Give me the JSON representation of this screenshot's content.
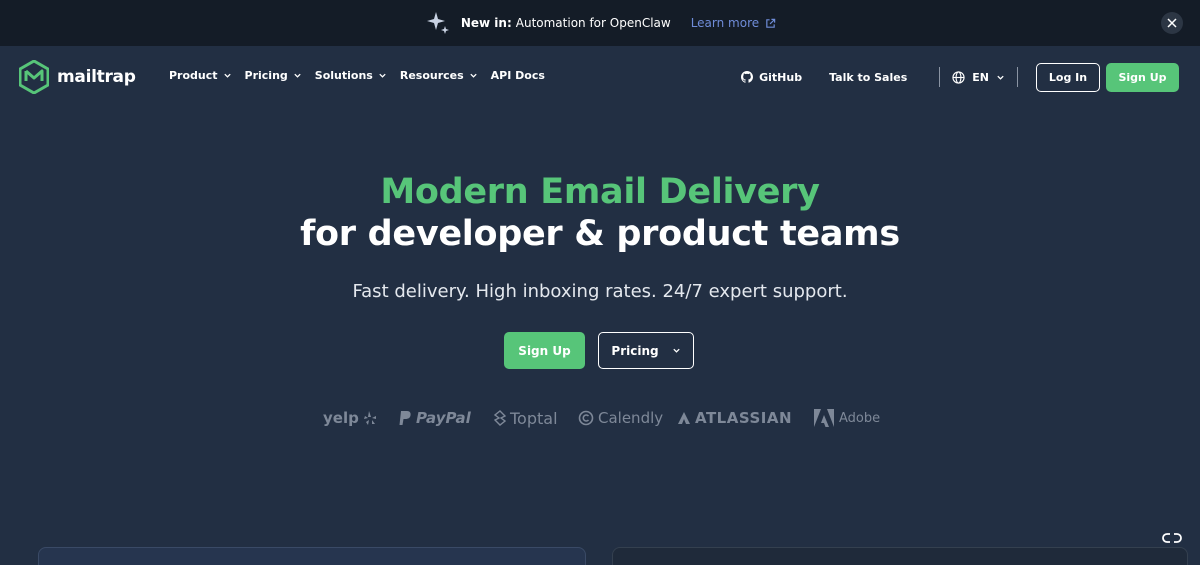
{
  "announcement": {
    "new_label": "New in:",
    "text": "Automation for OpenClaw",
    "link_label": "Learn more"
  },
  "nav": {
    "logo_text": "mailtrap",
    "menu": [
      {
        "label": "Product"
      },
      {
        "label": "Pricing"
      },
      {
        "label": "Solutions"
      },
      {
        "label": "Resources"
      },
      {
        "label": "API Docs"
      }
    ],
    "github_label": "GitHub",
    "talk_to_sales_label": "Talk to Sales",
    "language": "EN",
    "login_label": "Log In",
    "signup_label": "Sign Up"
  },
  "hero": {
    "title_line1": "Modern Email Delivery",
    "title_line2": "for developer & product teams",
    "subtitle": "Fast delivery. High inboxing rates. 24/7 expert support.",
    "signup_label": "Sign Up",
    "pricing_label": "Pricing"
  },
  "clients": [
    "yelp",
    "PayPal",
    "Toptal",
    "Calendly",
    "ATLASSIAN",
    "Adobe"
  ],
  "colors": {
    "accent_green": "#57c579",
    "background": "#222f43",
    "announcement_bg": "#141c27",
    "link_blue": "#6f8cd8"
  }
}
